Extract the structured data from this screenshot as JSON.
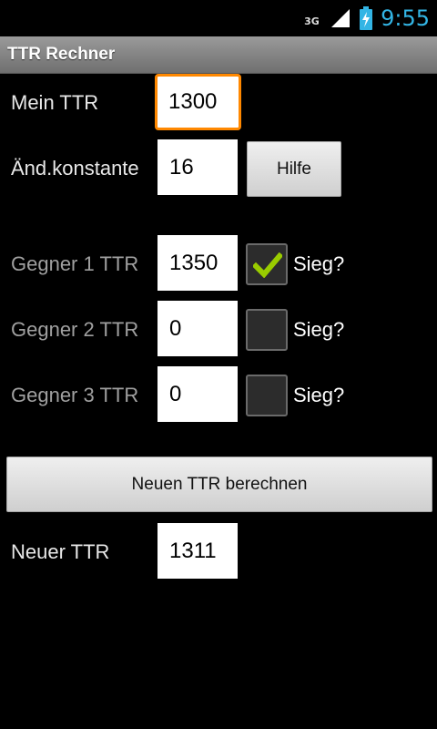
{
  "status_bar": {
    "network": "3G",
    "time": "9:55",
    "signal_icon": "signal-icon",
    "battery_icon": "battery-charging-icon"
  },
  "app": {
    "title": "TTR Rechner"
  },
  "form": {
    "my_ttr": {
      "label": "Mein TTR",
      "value": "1300"
    },
    "change_constant": {
      "label": "Änd.konstante",
      "value": "16"
    },
    "help_button": "Hilfe",
    "opponents": [
      {
        "label": "Gegner 1 TTR",
        "value": "1350",
        "win_label": "Sieg?",
        "win_checked": true
      },
      {
        "label": "Gegner 2 TTR",
        "value": "0",
        "win_label": "Sieg?",
        "win_checked": false
      },
      {
        "label": "Gegner 3 TTR",
        "value": "0",
        "win_label": "Sieg?",
        "win_checked": false
      }
    ],
    "calculate_button": "Neuen TTR berechnen",
    "new_ttr": {
      "label": "Neuer TTR",
      "value": "1311"
    }
  },
  "colors": {
    "accent_focus": "#ff8800",
    "clock": "#33b5e5",
    "checkmark": "#99cc00"
  }
}
